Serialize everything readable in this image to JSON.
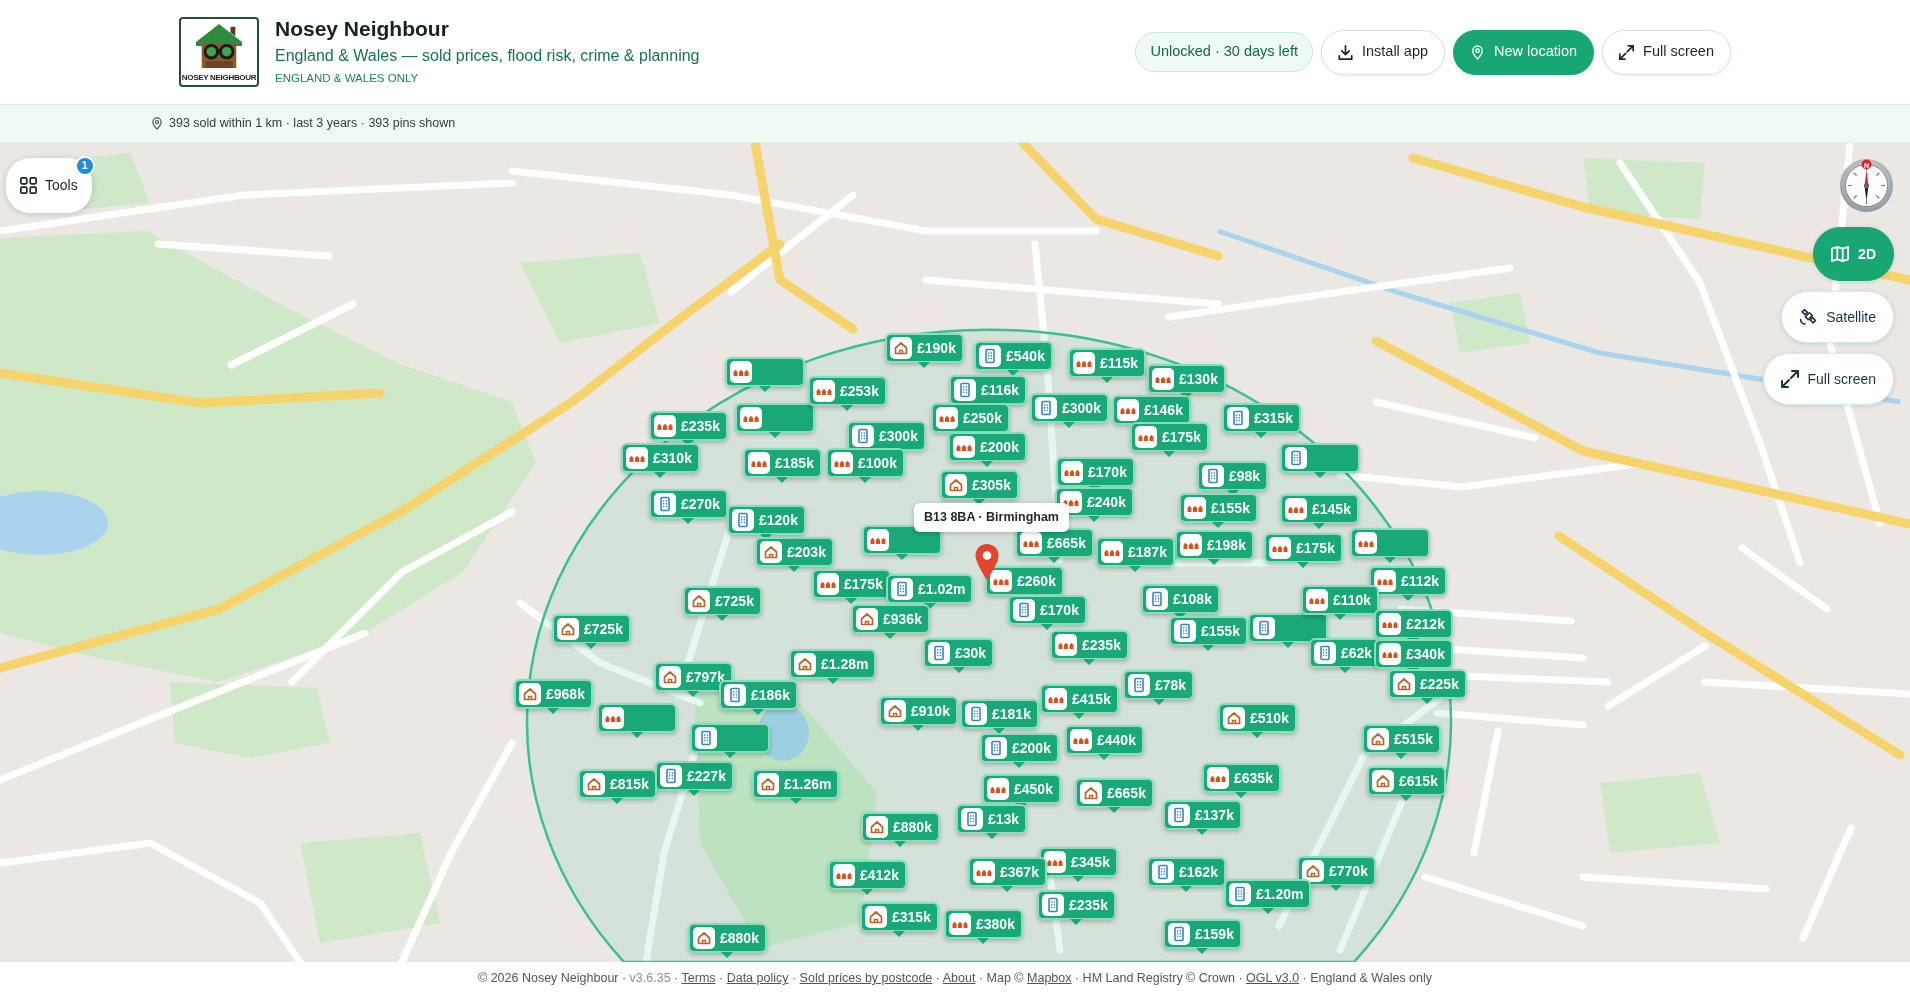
{
  "header": {
    "logo_text": "NOSEY NEIGHBOUR",
    "title": "Nosey Neighbour",
    "subtitle": "England & Wales — sold prices, flood risk, crime & planning",
    "region_note": "ENGLAND & WALES ONLY",
    "status_badge": "Unlocked · 30 days left",
    "buttons": [
      {
        "label": "Install app",
        "kind": "install",
        "primary": false
      },
      {
        "label": "New location",
        "kind": "location",
        "primary": true
      },
      {
        "label": "Full screen",
        "kind": "fullscreen",
        "primary": false
      }
    ]
  },
  "info_bar": {
    "text": "393 sold within 1 km · last 3 years · 393 pins shown"
  },
  "map": {
    "tools": {
      "label": "Tools",
      "badge": "1"
    },
    "compass_label": "N",
    "view_controls": [
      {
        "label": "2D",
        "kind": "map",
        "selected": true
      },
      {
        "label": "Satellite",
        "kind": "satellite",
        "selected": false
      },
      {
        "label": "Full screen",
        "kind": "fullscreen",
        "selected": false
      }
    ],
    "location_label": "B13 8BA · Birmingham",
    "pins": [
      {
        "kind": "house",
        "price": "£190k"
      },
      {
        "kind": "flat",
        "price": "£540k"
      },
      {
        "kind": "terrace",
        "price": "£115k"
      },
      {
        "kind": "terrace"
      },
      {
        "kind": "terrace",
        "price": "£130k"
      },
      {
        "kind": "terrace",
        "price": "£253k"
      },
      {
        "kind": "flat",
        "price": "£116k"
      },
      {
        "kind": "flat",
        "price": "£300k"
      },
      {
        "kind": "terrace",
        "price": "£146k"
      },
      {
        "kind": "terrace"
      },
      {
        "kind": "terrace",
        "price": "£250k"
      },
      {
        "kind": "flat",
        "price": "£315k"
      },
      {
        "kind": "terrace",
        "price": "£235k"
      },
      {
        "kind": "flat",
        "price": "£300k"
      },
      {
        "kind": "terrace",
        "price": "£175k"
      },
      {
        "kind": "terrace",
        "price": "£200k"
      },
      {
        "kind": "terrace",
        "price": "£310k"
      },
      {
        "kind": "terrace",
        "price": "£185k"
      },
      {
        "kind": "terrace",
        "price": "£100k"
      },
      {
        "kind": "flat"
      },
      {
        "kind": "terrace",
        "price": "£170k"
      },
      {
        "kind": "flat",
        "price": "£98k"
      },
      {
        "kind": "house",
        "price": "£305k"
      },
      {
        "kind": "flat",
        "price": "£270k"
      },
      {
        "kind": "terrace",
        "price": "£240k"
      },
      {
        "kind": "terrace",
        "price": "£155k"
      },
      {
        "kind": "terrace",
        "price": "£145k"
      },
      {
        "kind": "flat",
        "price": "£120k"
      },
      {
        "kind": "house",
        "price": "£203k"
      },
      {
        "kind": "terrace"
      },
      {
        "kind": "terrace",
        "price": "£665k"
      },
      {
        "kind": "terrace",
        "price": "£187k"
      },
      {
        "kind": "terrace",
        "price": "£198k"
      },
      {
        "kind": "terrace",
        "price": "£175k"
      },
      {
        "kind": "terrace"
      },
      {
        "kind": "terrace",
        "price": "£175k"
      },
      {
        "kind": "terrace",
        "price": "£260k"
      },
      {
        "kind": "terrace",
        "price": "£112k"
      },
      {
        "kind": "flat",
        "price": "£1.02m"
      },
      {
        "kind": "house",
        "price": "£725k"
      },
      {
        "kind": "flat",
        "price": "£108k"
      },
      {
        "kind": "terrace",
        "price": "£110k"
      },
      {
        "kind": "flat",
        "price": "£170k"
      },
      {
        "kind": "house",
        "price": "£725k"
      },
      {
        "kind": "house",
        "price": "£936k"
      },
      {
        "kind": "flat",
        "price": "£155k"
      },
      {
        "kind": "flat"
      },
      {
        "kind": "terrace",
        "price": "£212k"
      },
      {
        "kind": "terrace",
        "price": "£235k"
      },
      {
        "kind": "flat",
        "price": "£30k"
      },
      {
        "kind": "flat",
        "price": "£62k"
      },
      {
        "kind": "terrace",
        "price": "£340k"
      },
      {
        "kind": "house",
        "price": "£1.28m"
      },
      {
        "kind": "house",
        "price": "£797k"
      },
      {
        "kind": "flat",
        "price": "£78k"
      },
      {
        "kind": "house",
        "price": "£225k"
      },
      {
        "kind": "house",
        "price": "£968k"
      },
      {
        "kind": "flat",
        "price": "£186k"
      },
      {
        "kind": "terrace",
        "price": "£415k"
      },
      {
        "kind": "terrace"
      },
      {
        "kind": "house",
        "price": "£910k"
      },
      {
        "kind": "flat",
        "price": "£181k"
      },
      {
        "kind": "house",
        "price": "£510k"
      },
      {
        "kind": "flat"
      },
      {
        "kind": "terrace",
        "price": "£440k"
      },
      {
        "kind": "house",
        "price": "£515k"
      },
      {
        "kind": "flat",
        "price": "£200k"
      },
      {
        "kind": "house",
        "price": "£815k"
      },
      {
        "kind": "flat",
        "price": "£227k"
      },
      {
        "kind": "house",
        "price": "£1.26m"
      },
      {
        "kind": "terrace",
        "price": "£450k"
      },
      {
        "kind": "house",
        "price": "£665k"
      },
      {
        "kind": "terrace",
        "price": "£635k"
      },
      {
        "kind": "house",
        "price": "£615k"
      },
      {
        "kind": "flat",
        "price": "£13k"
      },
      {
        "kind": "flat",
        "price": "£137k"
      },
      {
        "kind": "house",
        "price": "£880k"
      },
      {
        "kind": "terrace",
        "price": "£345k"
      },
      {
        "kind": "terrace",
        "price": "£412k"
      },
      {
        "kind": "terrace",
        "price": "£367k"
      },
      {
        "kind": "flat",
        "price": "£162k"
      },
      {
        "kind": "house",
        "price": "£770k"
      },
      {
        "kind": "flat",
        "price": "£1.20m"
      },
      {
        "kind": "flat",
        "price": "£235k"
      },
      {
        "kind": "house",
        "price": "£315k"
      },
      {
        "kind": "terrace",
        "price": "£380k"
      },
      {
        "kind": "house",
        "price": "£880k"
      },
      {
        "kind": "flat",
        "price": "£159k"
      }
    ]
  },
  "footer": {
    "separator": "·",
    "segments": [
      [
        {
          "text": "© 2026 Nosey Neighbour",
          "kind": "text"
        }
      ],
      [
        {
          "text": "v3.6.35",
          "kind": "version"
        }
      ],
      [
        {
          "text": "Terms",
          "kind": "link"
        }
      ],
      [
        {
          "text": "Data policy",
          "kind": "link"
        }
      ],
      [
        {
          "text": "Sold prices by postcode",
          "kind": "link"
        }
      ],
      [
        {
          "text": "About",
          "kind": "link"
        }
      ],
      [
        {
          "text": "Map ©",
          "kind": "text"
        },
        {
          "text": "Mapbox",
          "kind": "link"
        }
      ],
      [
        {
          "text": "HM Land Registry © Crown",
          "kind": "text"
        }
      ],
      [
        {
          "text": "OGL v3.0",
          "kind": "link"
        }
      ],
      [
        {
          "text": "England & Wales only",
          "kind": "text"
        }
      ]
    ]
  }
}
